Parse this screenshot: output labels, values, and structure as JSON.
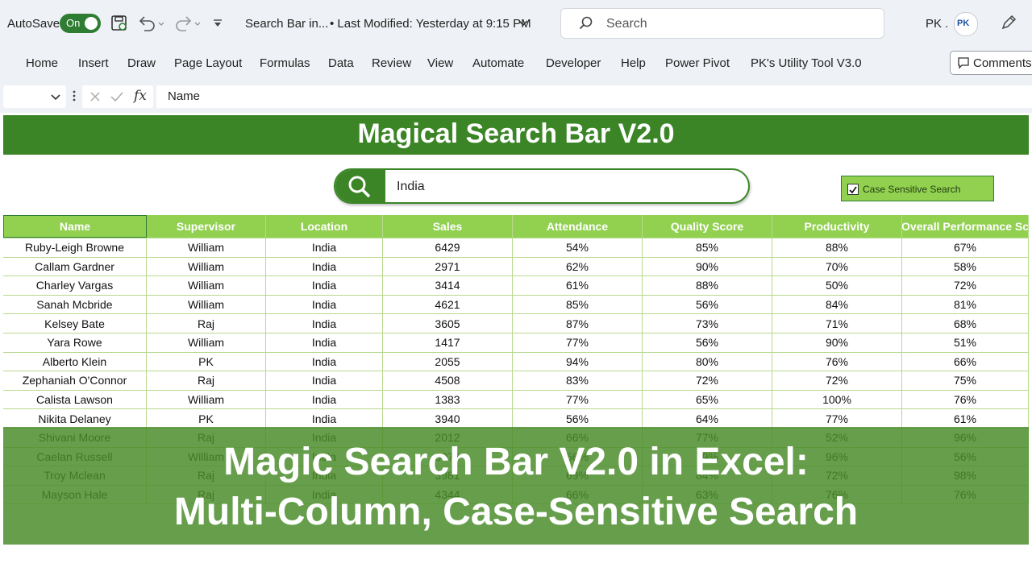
{
  "titlebar": {
    "autosave_label": "AutoSave",
    "toggle_label": "On",
    "file_name": "Search Bar in...",
    "last_modified": "• Last Modified: Yesterday at 9:15 PM",
    "search_placeholder": "Search",
    "user_initials": "PK .",
    "avatar_text": "PK"
  },
  "ribbon": {
    "tabs": [
      "Home",
      "Insert",
      "Draw",
      "Page Layout",
      "Formulas",
      "Data",
      "Review",
      "View",
      "Automate",
      "Developer",
      "Help",
      "Power Pivot",
      "PK's Utility Tool V3.0"
    ],
    "comments_label": "Comments"
  },
  "formula_bar": {
    "fx_label": "fx",
    "content": "Name"
  },
  "sheet": {
    "header_title": "Magical Search Bar V2.0",
    "search_value": "India",
    "case_sensitive_label": "Case Sensitive Search",
    "case_sensitive_checked": true,
    "columns": [
      "Name",
      "Supervisor",
      "Location",
      "Sales",
      "Attendance",
      "Quality Score",
      "Productivity",
      "Overall Performance Sc"
    ],
    "rows": [
      [
        "Ruby-Leigh Browne",
        "William",
        "India",
        "6429",
        "54%",
        "85%",
        "88%",
        "67%"
      ],
      [
        "Callam Gardner",
        "William",
        "India",
        "2971",
        "62%",
        "90%",
        "70%",
        "58%"
      ],
      [
        "Charley Vargas",
        "William",
        "India",
        "3414",
        "61%",
        "88%",
        "50%",
        "72%"
      ],
      [
        "Sanah Mcbride",
        "William",
        "India",
        "4621",
        "85%",
        "56%",
        "84%",
        "81%"
      ],
      [
        "Kelsey Bate",
        "Raj",
        "India",
        "3605",
        "87%",
        "73%",
        "71%",
        "68%"
      ],
      [
        "Yara Rowe",
        "William",
        "India",
        "1417",
        "77%",
        "56%",
        "90%",
        "51%"
      ],
      [
        "Alberto Klein",
        "PK",
        "India",
        "2055",
        "94%",
        "80%",
        "76%",
        "66%"
      ],
      [
        "Zephaniah O'Connor",
        "Raj",
        "India",
        "4508",
        "83%",
        "72%",
        "72%",
        "75%"
      ],
      [
        "Calista Lawson",
        "William",
        "India",
        "1383",
        "77%",
        "65%",
        "100%",
        "76%"
      ],
      [
        "Nikita Delaney",
        "PK",
        "India",
        "3940",
        "56%",
        "64%",
        "77%",
        "61%"
      ],
      [
        "Shivani Moore",
        "Raj",
        "India",
        "2012",
        "66%",
        "77%",
        "52%",
        "96%"
      ],
      [
        "Caelan Russell",
        "William",
        "India",
        "3978",
        "56%",
        "79%",
        "96%",
        "56%"
      ],
      [
        "Troy Mclean",
        "Raj",
        "India",
        "3981",
        "69%",
        "84%",
        "72%",
        "98%"
      ],
      [
        "Mayson Hale",
        "Raj",
        "India",
        "4344",
        "66%",
        "63%",
        "76%",
        "76%"
      ]
    ]
  },
  "overlay": {
    "line1": "Magic Search Bar V2.0 in Excel:",
    "line2": "Multi-Column, Case-Sensitive Search"
  },
  "colors": {
    "accent_green": "#3b8527",
    "table_header_green": "#92d050",
    "overlay_green": "#4a8c2a"
  }
}
